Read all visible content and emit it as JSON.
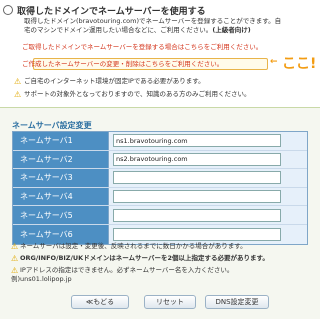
{
  "option": {
    "title": "取得したドメインでネームサーバーを使用する",
    "line1": "取得したドメイン(bravotouring.com)でネームサーバーを登録することができます。自",
    "line2a": "宅のマシンでドメイン運用したい場合などに、ご利用ください。",
    "line2b": "(上級者向け)",
    "red1": "ご取得したドメインでネームサーバーを登録する場合はこちらをご利用ください。",
    "red2": "ご作成したネームサーバーの変更・削除はこちらをご利用ください。",
    "arrow": "←",
    "annotation": "ここ!",
    "warn1": "ご自宅のインターネット環境が固定IPである必要があります。",
    "warn2": "サポートの対象外となっておりますので、知識のある方のみご利用ください。"
  },
  "nameservers": {
    "heading": "ネームサーバ設定変更",
    "rows": [
      {
        "label": "ネームサーバ1",
        "value": "ns1.bravotouring.com"
      },
      {
        "label": "ネームサーバ2",
        "value": "ns2.bravotouring.com"
      },
      {
        "label": "ネームサーバ3",
        "value": ""
      },
      {
        "label": "ネームサーバ4",
        "value": ""
      },
      {
        "label": "ネームサーバ5",
        "value": ""
      },
      {
        "label": "ネームサーバ6",
        "value": ""
      }
    ]
  },
  "notes": {
    "n1": "ネームサーバは設定・変更後、反映されるまでに数日かかる場合があります。",
    "n2": "ORG/INFO/BIZ/UKドメインはネームサーバーを2個以上指定する必要があります。",
    "n3a": "IPアドレスの指定はできません。必ずネームサーバー名を入力ください。",
    "n3b": "例)uns01.lolipop.jp"
  },
  "buttons": {
    "back": "≪もどる",
    "reset": "リセット",
    "submit": "DNS設定変更"
  },
  "colors": {
    "accent": "#4d8fc3",
    "warning": "#e0a800",
    "alert_red": "#d4351c",
    "annotation": "#f39c12"
  }
}
